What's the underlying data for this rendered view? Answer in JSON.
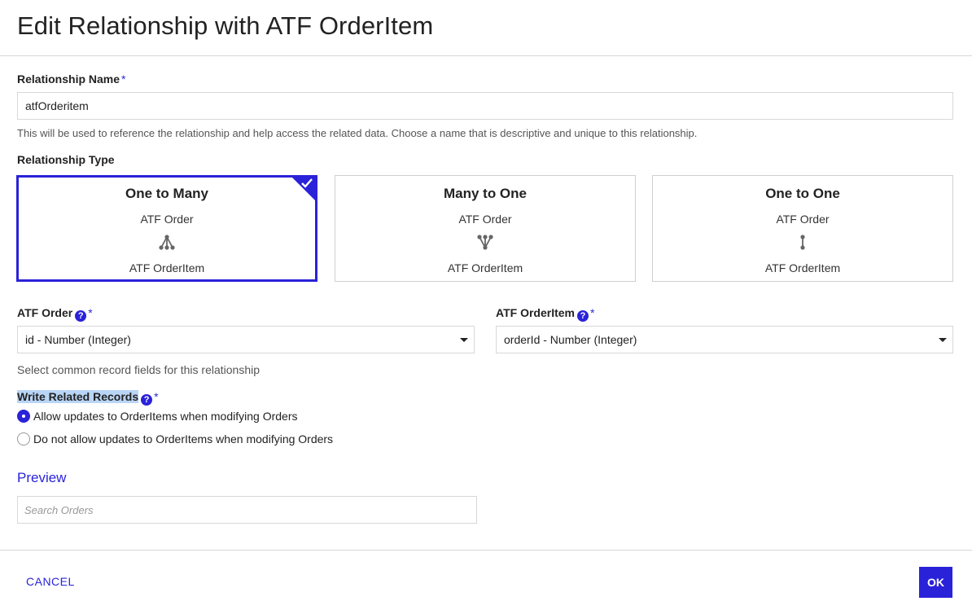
{
  "dialog": {
    "title": "Edit Relationship with ATF OrderItem"
  },
  "relationship_name": {
    "label": "Relationship Name",
    "required_mark": "*",
    "value": "atfOrderitem",
    "help": "This will be used to reference the relationship and help access the related data. Choose a name that is descriptive and unique to this relationship."
  },
  "relationship_type": {
    "label": "Relationship Type",
    "options": [
      {
        "title": "One to Many",
        "from": "ATF Order",
        "to": "ATF OrderItem",
        "icon": "one-to-many-icon",
        "selected": true
      },
      {
        "title": "Many to One",
        "from": "ATF Order",
        "to": "ATF OrderItem",
        "icon": "many-to-one-icon",
        "selected": false
      },
      {
        "title": "One to One",
        "from": "ATF Order",
        "to": "ATF OrderItem",
        "icon": "one-to-one-icon",
        "selected": false
      }
    ]
  },
  "fields": {
    "left": {
      "label": "ATF Order",
      "required_mark": "*",
      "help_icon": "?",
      "value": "id - Number (Integer)"
    },
    "right": {
      "label": "ATF OrderItem",
      "required_mark": "*",
      "help_icon": "?",
      "value": "orderId - Number (Integer)"
    },
    "help": "Select common record fields for this relationship"
  },
  "write_related": {
    "label": "Write Related Records",
    "required_mark": "*",
    "help_icon": "?",
    "options": [
      {
        "label": "Allow updates to OrderItems when modifying Orders",
        "selected": true
      },
      {
        "label": "Do not allow updates to OrderItems when modifying Orders",
        "selected": false
      }
    ]
  },
  "preview": {
    "title": "Preview",
    "search_placeholder": "Search Orders"
  },
  "footer": {
    "cancel_label": "CANCEL",
    "ok_label": "OK"
  },
  "colors": {
    "accent": "#2a22d9",
    "highlight": "#b9d5f5",
    "border": "#d8d8d8"
  }
}
